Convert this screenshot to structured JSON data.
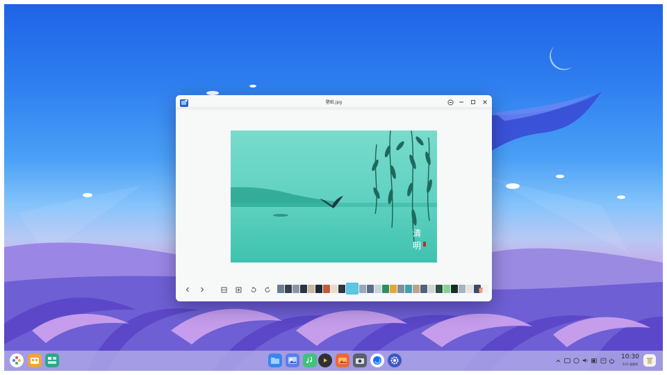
{
  "window": {
    "title": "壁纸.jpg",
    "photo_caption": [
      "清",
      "明"
    ]
  },
  "toolbar": {
    "items": [
      "prev-icon",
      "next-icon",
      "fit-window-icon",
      "original-size-icon",
      "rotate-left-icon",
      "rotate-right-icon",
      "delete-icon"
    ],
    "thumb_colors": [
      "#6b7d96",
      "#3a3f4c",
      "#8a95a8",
      "#2b3441",
      "#c7b8a2",
      "#1c2a36",
      "#c25a3a",
      "#e9dccb",
      "#2e3845",
      "#9aa8b8",
      "#5c6e85",
      "#c2d6de",
      "#2b8f63",
      "#e8a537",
      "#7e8f9e",
      "#3ea2b0",
      "#bba28a",
      "#51627a",
      "#d0d6d8",
      "#2f4f44",
      "#86d19a",
      "#182e24",
      "#a7b3bf",
      "#e3e4e0",
      "#3f4a63",
      "#f1f1ee"
    ],
    "selected_thumb_color": "#5dc7e0"
  },
  "taskbar": {
    "clock_time": "10:30",
    "clock_date": "5/12 星期四",
    "apps": [
      "launcher-icon",
      "app-store-icon",
      "multitask-view-icon",
      "file-manager-icon",
      "image-viewer-icon",
      "music-icon",
      "video-player-icon",
      "gallery-icon",
      "camera-icon",
      "browser-icon",
      "settings-icon"
    ],
    "tray": [
      "tray-expand-icon",
      "keyboard-icon",
      "network-icon",
      "volume-icon",
      "battery-icon",
      "notifications-icon",
      "power-icon"
    ]
  },
  "colors": {
    "accent": "#0081ff",
    "photo_bg": "#4cc9b8",
    "taskbar": "#b0aae8"
  }
}
